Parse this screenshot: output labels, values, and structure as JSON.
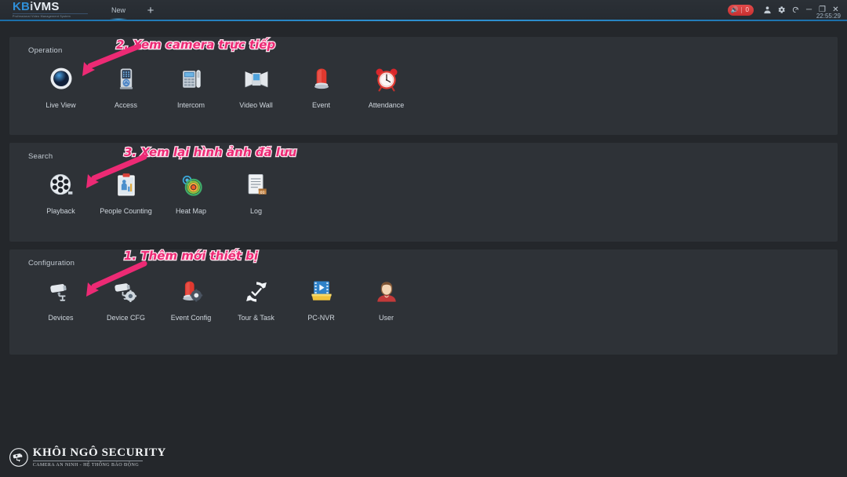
{
  "titlebar": {
    "logo_kb": "KB",
    "logo_i": "i",
    "logo_vms": "VMS",
    "logo_subtitle": "Professional Video Management System",
    "tab_label": "New",
    "add_tab_label": "+",
    "alarm_icon": "bell-icon",
    "alarm_count": "0",
    "user_icon": "user-icon",
    "settings_icon": "gear-icon",
    "help_icon": "dashboard-icon",
    "minimize_label": "─",
    "maximize_label": "❐",
    "close_label": "✕",
    "clock": "22:55:29"
  },
  "sections": [
    {
      "label": "Operation",
      "items": [
        {
          "label": "Live View",
          "icon": "dome-camera-icon"
        },
        {
          "label": "Access",
          "icon": "access-control-icon"
        },
        {
          "label": "Intercom",
          "icon": "intercom-phone-icon"
        },
        {
          "label": "Video Wall",
          "icon": "video-wall-icon"
        },
        {
          "label": "Event",
          "icon": "siren-icon"
        },
        {
          "label": "Attendance",
          "icon": "alarm-clock-icon"
        }
      ]
    },
    {
      "label": "Search",
      "items": [
        {
          "label": "Playback",
          "icon": "film-reel-icon"
        },
        {
          "label": "People Counting",
          "icon": "clipboard-people-icon"
        },
        {
          "label": "Heat Map",
          "icon": "heat-map-icon"
        },
        {
          "label": "Log",
          "icon": "log-document-icon"
        }
      ]
    },
    {
      "label": "Configuration",
      "items": [
        {
          "label": "Devices",
          "icon": "bullet-camera-icon"
        },
        {
          "label": "Device CFG",
          "icon": "camera-gear-icon"
        },
        {
          "label": "Event Config",
          "icon": "siren-gear-icon"
        },
        {
          "label": "Tour & Task",
          "icon": "refresh-check-icon"
        },
        {
          "label": "PC-NVR",
          "icon": "nvr-media-icon"
        },
        {
          "label": "User",
          "icon": "user-avatar-icon"
        }
      ]
    }
  ],
  "annotations": [
    {
      "id": "anno-1",
      "text": "1. Thêm mới thiết bị"
    },
    {
      "id": "anno-2",
      "text": "2. Xem camera trực tiếp"
    },
    {
      "id": "anno-3",
      "text": "3. Xem lại hình ảnh đã lưu"
    }
  ],
  "watermark": {
    "title": "KHÔI  NGÔ SECURITY",
    "subtitle": "CAMERA AN NINH - HỆ THỐNG BÁO ĐỘNG",
    "icon": "cctv-camera-icon"
  },
  "colors": {
    "accent_blue": "#2d8fcf",
    "annotation_pink": "#ec2a74",
    "panel_bg": "#2e3237",
    "page_bg": "#24272b",
    "alarm_red": "#c62f2f"
  }
}
